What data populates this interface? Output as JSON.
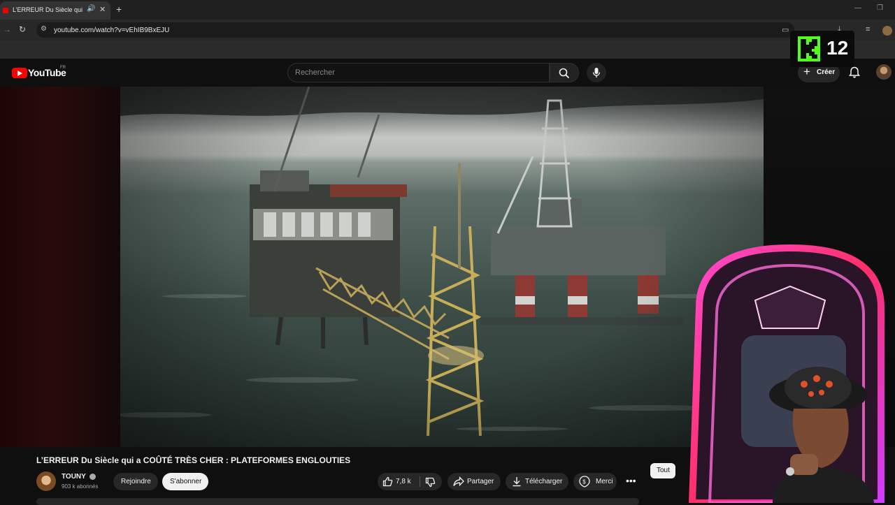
{
  "browser": {
    "tab_title": "L’ERREUR Du Siècle qui a C",
    "new_tab": "+",
    "tab_close": "✕",
    "url": "youtube.com/watch?v=vEhIB9BxEJU"
  },
  "header": {
    "logo_text": "YouTube",
    "region": "FR",
    "search_placeholder": "Rechercher",
    "create_label": "Créer"
  },
  "overlay_badge": {
    "number": "12",
    "brand_color": "#53fc18"
  },
  "video": {
    "title": "L’ERREUR Du Siècle qui a COÛTÉ TRÈS CHER : PLATEFORMES ENGLOUTIES",
    "channel": "TOUNY",
    "subscribers": "903 k abonnés",
    "join_label": "Rejoindre",
    "subscribe_label": "S'abonner",
    "likes": "7,8 k",
    "share_label": "Partager",
    "download_label": "Télécharger",
    "thanks_label": "Merci",
    "more_label": "•••"
  },
  "chips": {
    "tout": "Tout"
  },
  "colors": {
    "youtube_red": "#ff0000",
    "background": "#0f0f0f"
  }
}
